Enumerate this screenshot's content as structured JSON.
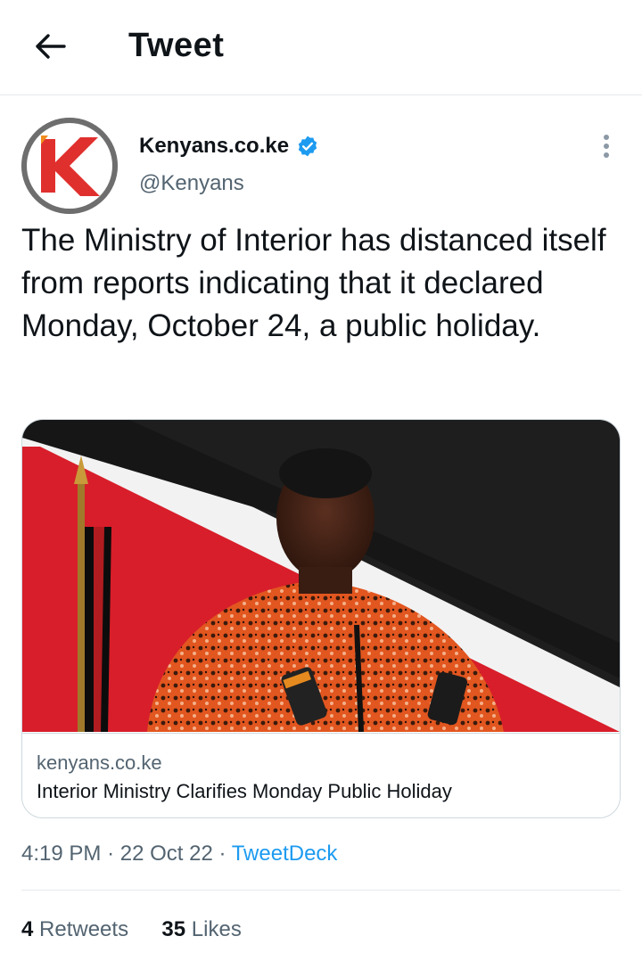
{
  "header": {
    "title": "Tweet"
  },
  "author": {
    "name": "Kenyans.co.ke",
    "handle": "@Kenyans"
  },
  "tweet": {
    "text": "The Ministry of Interior has distanced itself from reports indicating that it declared Monday, October 24, a public holiday."
  },
  "card": {
    "domain": "kenyans.co.ke",
    "title": "Interior Ministry Clarifies Monday Public Holiday"
  },
  "meta": {
    "time": "4:19 PM",
    "date": "22 Oct 22",
    "source": "TweetDeck",
    "sep": "·"
  },
  "stats": {
    "retweets_count": "4",
    "retweets_label": "Retweets",
    "likes_count": "35",
    "likes_label": "Likes"
  },
  "colors": {
    "accent": "#1d9bf0",
    "muted": "#536471",
    "text": "#0f1419"
  },
  "icons": [
    "back-arrow-icon",
    "verified-badge-icon",
    "more-options-icon"
  ]
}
